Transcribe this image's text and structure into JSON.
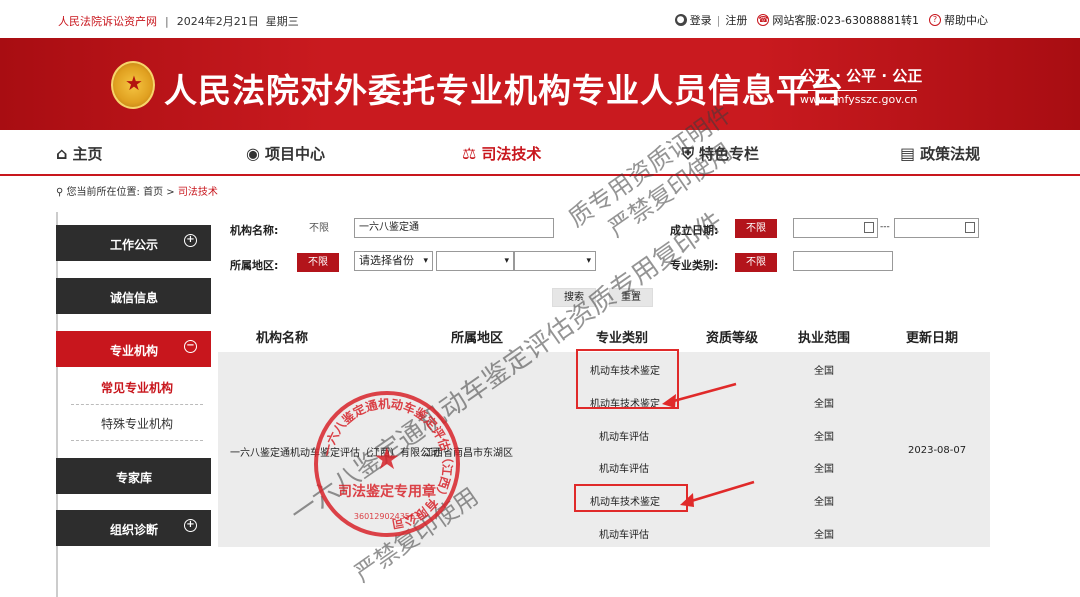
{
  "topbar": {
    "site": "人民法院诉讼资产网",
    "separator": "|",
    "date": "2024年2月21日",
    "weekday": "星期三",
    "login": "登录",
    "divider": "|",
    "register": "注册",
    "service": "网站客服:023-63088881转1",
    "help": "帮助中心"
  },
  "banner": {
    "title": "人民法院对外委托专业机构专业人员信息平台",
    "slogan": "公开 · 公平 · 公正",
    "url": "www.rmfysszc.gov.cn"
  },
  "nav": {
    "items": [
      {
        "label": "主页",
        "icon": "home-icon"
      },
      {
        "label": "项目中心",
        "icon": "project-icon"
      },
      {
        "label": "司法技术",
        "icon": "scale-icon"
      },
      {
        "label": "特色专栏",
        "icon": "shield-icon"
      },
      {
        "label": "政策法规",
        "icon": "book-icon"
      }
    ],
    "active": "司法技术"
  },
  "breadcrumb": {
    "prefix": "您当前所在位置:",
    "home": "首页",
    "sep": ">",
    "current": "司法技术"
  },
  "sidebar": {
    "work": "工作公示",
    "credit": "诚信信息",
    "org": "专业机构",
    "sub_common": "常见专业机构",
    "sub_special": "特殊专业机构",
    "experts": "专家库",
    "diagnosis": "组织诊断",
    "plus": "+",
    "minus": "−"
  },
  "filters": {
    "name_label": "机构名称:",
    "name_unlimited": "不限",
    "name_value": "一六八鉴定通",
    "date_label": "成立日期:",
    "date_unlimited": "不限",
    "date_sep": "---",
    "region_label": "所属地区:",
    "region_unlimited": "不限",
    "province_placeholder": "请选择省份",
    "type_label": "专业类别:",
    "type_unlimited": "不限",
    "search": "搜索",
    "reset": "重置"
  },
  "table": {
    "headers": [
      "机构名称",
      "所属地区",
      "专业类别",
      "资质等级",
      "执业范围",
      "更新日期"
    ],
    "org_name": "一六八鉴定通机动车鉴定评估（江西）有限公司",
    "region": "江西省南昌市东湖区",
    "update_date": "2023-08-07",
    "rows": [
      {
        "category": "机动车技术鉴定",
        "scope": "全国"
      },
      {
        "category": "机动车技术鉴定",
        "scope": "全国"
      },
      {
        "category": "机动车评估",
        "scope": "全国"
      },
      {
        "category": "机动车评估",
        "scope": "全国"
      },
      {
        "category": "机动车技术鉴定",
        "scope": "全国"
      },
      {
        "category": "机动车评估",
        "scope": "全国"
      }
    ]
  },
  "watermark": {
    "line1": "严禁复印使用",
    "line2": "质专用资质证明件",
    "line3": "一六八鉴定通机动车鉴定评估资质专用复印件",
    "line4": "严禁复印使用"
  },
  "stamp": {
    "ring_text": "一六八鉴定通机动车鉴定评估（江西）有限公司",
    "center_text": "司法鉴定专用章",
    "number": "3601290243563"
  },
  "colors": {
    "brand_red": "#c8161d",
    "banner_red": "#c91a1f",
    "sidebar_dark": "#2d2d2d",
    "highlight_box": "#e02a2a"
  }
}
